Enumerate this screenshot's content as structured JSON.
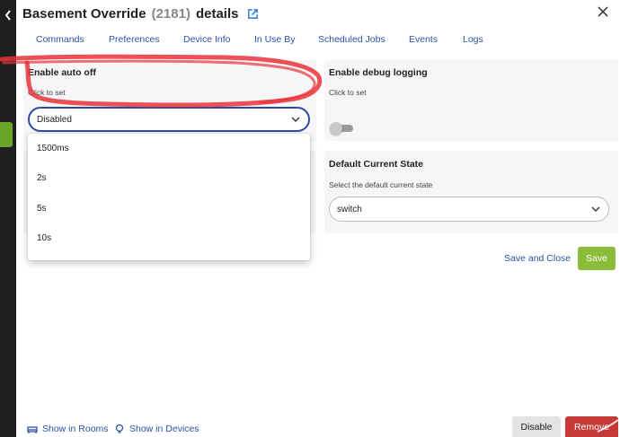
{
  "dialog": {
    "title": "Basement Override",
    "device_id": "(2181)",
    "title_suffix": "details"
  },
  "tabs": [
    "Commands",
    "Preferences",
    "Device Info",
    "In Use By",
    "Scheduled Jobs",
    "Events",
    "Logs"
  ],
  "preferences": {
    "auto_off": {
      "label": "Enable auto off",
      "hint": "Click to set",
      "selected": "Disabled",
      "options": [
        "1500ms",
        "2s",
        "5s",
        "10s"
      ]
    },
    "debug_logging": {
      "label": "Enable debug logging",
      "hint": "Click to set",
      "enabled": false
    },
    "default_state": {
      "label": "Default Current State",
      "hint": "Select the default current state",
      "selected": "switch"
    }
  },
  "actions": {
    "save_and_close": "Save and Close",
    "save": "Save"
  },
  "footer": {
    "show_in_rooms": "Show in Rooms",
    "show_in_devices": "Show in Devices",
    "disable": "Disable",
    "remove": "Remove"
  },
  "colors": {
    "accent_blue": "#2a52a8",
    "save_green": "#8cbd3a",
    "remove_red": "#c53a36",
    "annotation_red": "#e8333a"
  }
}
